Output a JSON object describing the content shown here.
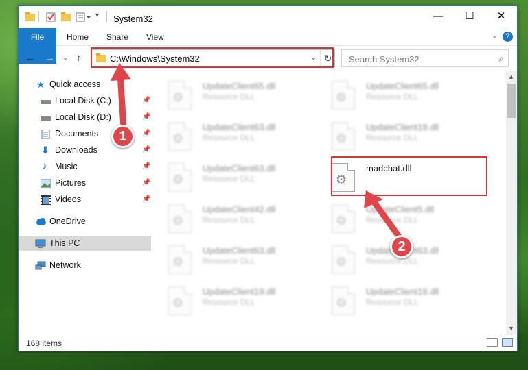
{
  "window": {
    "title": "System32",
    "min_icon": "minimize-icon",
    "max_icon": "maximize-icon",
    "close_icon": "close-icon"
  },
  "ribbon": {
    "tabs": [
      "File",
      "Home",
      "Share",
      "View"
    ],
    "help": "?"
  },
  "nav": {
    "address": "C:\\Windows\\System32",
    "search_placeholder": "Search System32"
  },
  "sidebar": {
    "items": [
      {
        "label": "Quick access",
        "icon": "star-icon",
        "pinned": false
      },
      {
        "label": "Local Disk (C:)",
        "icon": "drive-icon",
        "pinned": true
      },
      {
        "label": "Local Disk (D:)",
        "icon": "drive-icon",
        "pinned": true
      },
      {
        "label": "Documents",
        "icon": "documents-icon",
        "pinned": true
      },
      {
        "label": "Downloads",
        "icon": "download-icon",
        "pinned": true
      },
      {
        "label": "Music",
        "icon": "music-icon",
        "pinned": true
      },
      {
        "label": "Pictures",
        "icon": "pictures-icon",
        "pinned": true
      },
      {
        "label": "Videos",
        "icon": "videos-icon",
        "pinned": true
      },
      {
        "label": "OneDrive",
        "icon": "cloud-icon",
        "pinned": false
      },
      {
        "label": "This PC",
        "icon": "computer-icon",
        "pinned": false,
        "selected": true
      },
      {
        "label": "Network",
        "icon": "network-icon",
        "pinned": false
      }
    ]
  },
  "files": [
    {
      "name": "UpdateClient65.dll",
      "type": "Resource DLL"
    },
    {
      "name": "UpdateClient65.dll",
      "type": "Resource DLL"
    },
    {
      "name": "UpdateClient63.dll",
      "type": "Resource DLL"
    },
    {
      "name": "UpdateClient19.dll",
      "type": "Resource DLL"
    },
    {
      "name": "UpdateClient63.dll",
      "type": "Resource DLL"
    },
    {
      "name": "madchat.dll",
      "type": ""
    },
    {
      "name": "UpdateClient42.dll",
      "type": "Resource DLL"
    },
    {
      "name": "UpdateClient5.dll",
      "type": "Resource DLL"
    },
    {
      "name": "UpdateClient63.dll",
      "type": "Resource DLL"
    },
    {
      "name": "UpdateClient63.dll",
      "type": "Resource DLL"
    },
    {
      "name": "UpdateClient19.dll",
      "type": "Resource DLL"
    },
    {
      "name": "UpdateClient19.dll",
      "type": "Resource DLL"
    }
  ],
  "status": {
    "count": "168 items"
  },
  "annotations": {
    "badge1": "1",
    "badge2": "2"
  },
  "colors": {
    "accent": "#1979ca",
    "highlight": "#d9363a"
  }
}
